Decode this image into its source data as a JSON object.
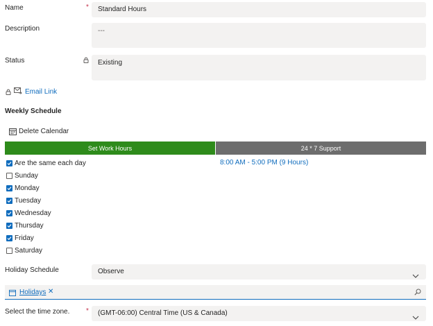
{
  "form": {
    "name": {
      "label": "Name",
      "value": "Standard Hours",
      "required": "*"
    },
    "description": {
      "label": "Description",
      "value": "---"
    },
    "status": {
      "label": "Status",
      "value": "Existing"
    },
    "email_link": "Email Link",
    "weekly_schedule_title": "Weekly Schedule",
    "delete_calendar": "Delete Calendar"
  },
  "tabs": [
    {
      "label": "Set Work Hours",
      "color": "#2e8b1b",
      "selected": true
    },
    {
      "label": "24 * 7 Support",
      "color": "#6d6d6d",
      "selected": false
    }
  ],
  "schedule": {
    "same_each_day": {
      "label": "Are the same each day",
      "checked": true
    },
    "hours": "8:00 AM - 5:00 PM (9 Hours)",
    "days": [
      {
        "label": "Sunday",
        "checked": false
      },
      {
        "label": "Monday",
        "checked": true
      },
      {
        "label": "Tuesday",
        "checked": true
      },
      {
        "label": "Wednesday",
        "checked": true
      },
      {
        "label": "Thursday",
        "checked": true
      },
      {
        "label": "Friday",
        "checked": true
      },
      {
        "label": "Saturday",
        "checked": false
      }
    ]
  },
  "holiday": {
    "label": "Holiday Schedule",
    "value": "Observe",
    "lookup_tag": "Holidays",
    "remove_glyph": "✕"
  },
  "timezone": {
    "label": "Select the time zone.",
    "required": "*",
    "value": "(GMT-06:00) Central Time (US & Canada)"
  },
  "colors": {
    "accent": "#0f6cbd",
    "required": "#c4314b",
    "field_bg": "#f3f2f1"
  }
}
